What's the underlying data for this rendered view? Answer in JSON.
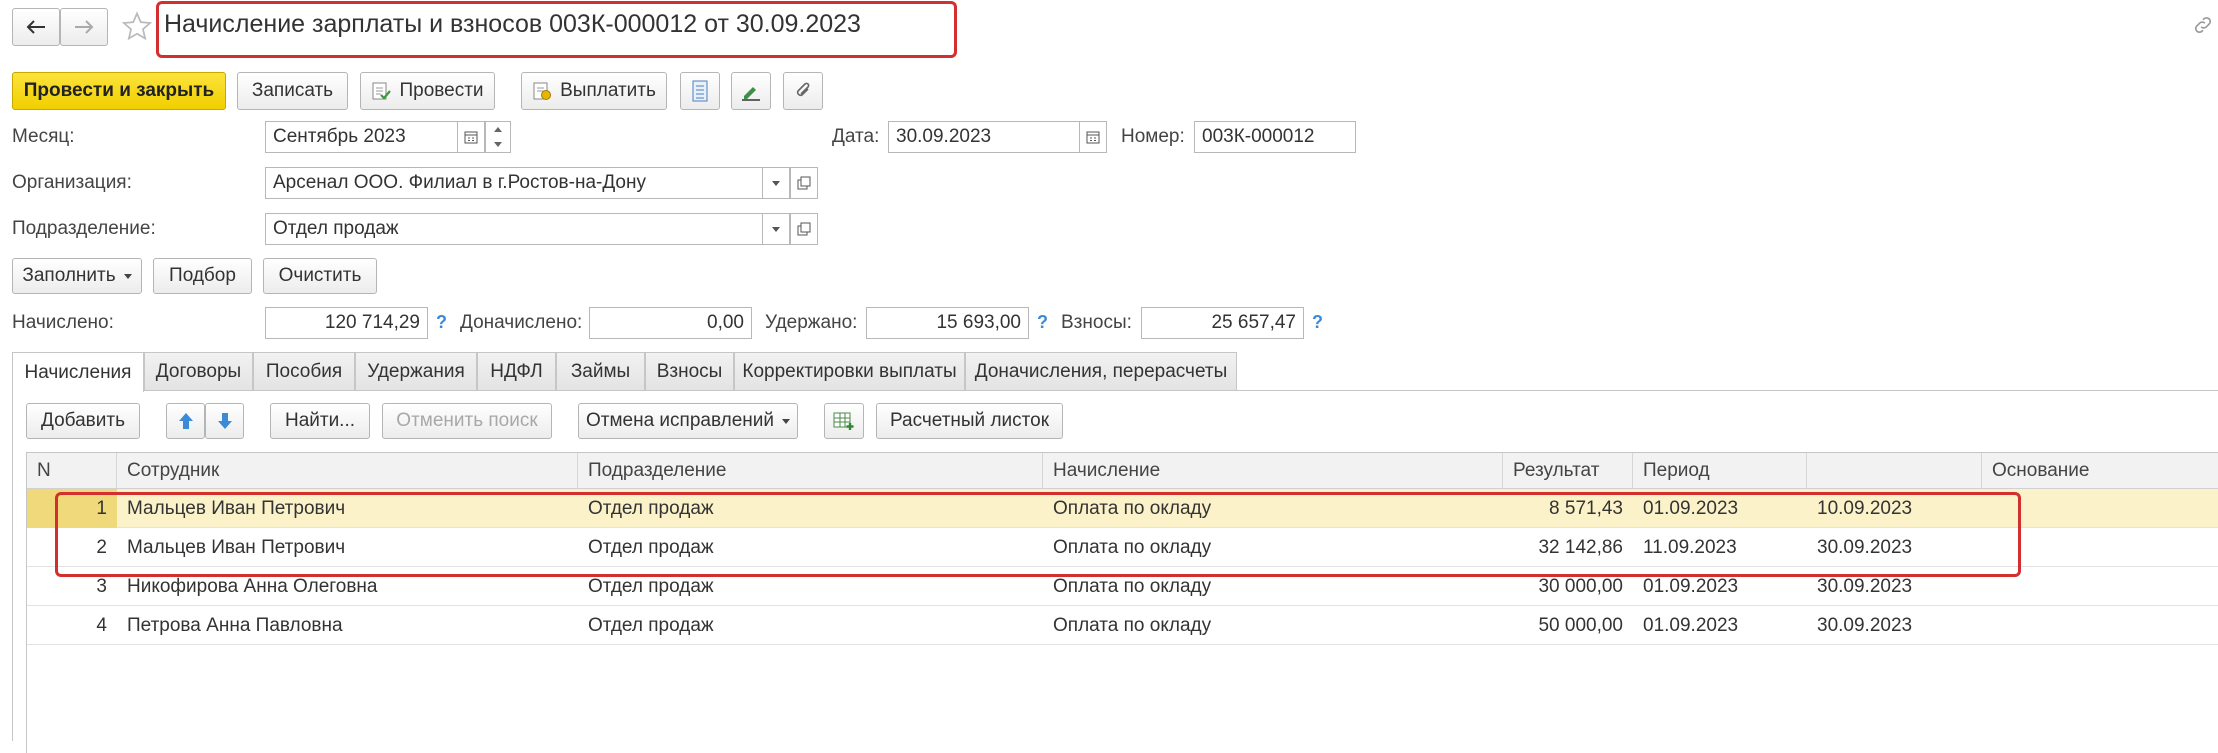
{
  "title": "Начисление зарплаты и взносов 003К-000012 от 30.09.2023",
  "toolbar": {
    "post_close": "Провести и закрыть",
    "save": "Записать",
    "post": "Провести",
    "pay": "Выплатить"
  },
  "fields": {
    "month_label": "Месяц:",
    "month_value": "Сентябрь 2023",
    "date_label": "Дата:",
    "date_value": "30.09.2023",
    "number_label": "Номер:",
    "number_value": "003К-000012",
    "org_label": "Организация:",
    "org_value": "Арсенал ООО. Филиал в г.Ростов-на-Дону",
    "dept_label": "Подразделение:",
    "dept_value": "Отдел продаж"
  },
  "actions": {
    "fill": "Заполнить",
    "select": "Подбор",
    "clear": "Очистить"
  },
  "totals": {
    "accrued_label": "Начислено:",
    "accrued_value": "120 714,29",
    "additional_label": "Доначислено:",
    "additional_value": "0,00",
    "withheld_label": "Удержано:",
    "withheld_value": "15 693,00",
    "contrib_label": "Взносы:",
    "contrib_value": "25 657,47",
    "help": "?"
  },
  "tabs": [
    "Начисления",
    "Договоры",
    "Пособия",
    "Удержания",
    "НДФЛ",
    "Займы",
    "Взносы",
    "Корректировки выплаты",
    "Доначисления, перерасчеты"
  ],
  "grid_toolbar": {
    "add": "Добавить",
    "find": "Найти...",
    "cancel_search": "Отменить поиск",
    "cancel_fixes": "Отмена исправлений",
    "payslip": "Расчетный листок"
  },
  "table": {
    "columns": [
      "N",
      "Сотрудник",
      "Подразделение",
      "Начисление",
      "Результат",
      "Период",
      "",
      "Основание"
    ],
    "rows": [
      {
        "n": "1",
        "employee": "Мальцев Иван Петрович",
        "dept": "Отдел продаж",
        "accrual": "Оплата по окладу",
        "result": "8 571,43",
        "from": "01.09.2023",
        "to": "10.09.2023",
        "basis": ""
      },
      {
        "n": "2",
        "employee": "Мальцев Иван Петрович",
        "dept": "Отдел продаж",
        "accrual": "Оплата по окладу",
        "result": "32 142,86",
        "from": "11.09.2023",
        "to": "30.09.2023",
        "basis": ""
      },
      {
        "n": "3",
        "employee": "Никофирова Анна Олеговна",
        "dept": "Отдел продаж",
        "accrual": "Оплата по окладу",
        "result": "30 000,00",
        "from": "01.09.2023",
        "to": "30.09.2023",
        "basis": ""
      },
      {
        "n": "4",
        "employee": "Петрова Анна Павловна",
        "dept": "Отдел продаж",
        "accrual": "Оплата по окладу",
        "result": "50 000,00",
        "from": "01.09.2023",
        "to": "30.09.2023",
        "basis": ""
      }
    ]
  },
  "colors": {
    "primary_button": "#f2cf00",
    "selected_row": "#fbf2c9",
    "highlight_frame": "#d32f2f",
    "help_mark": "#3b8ad8"
  }
}
